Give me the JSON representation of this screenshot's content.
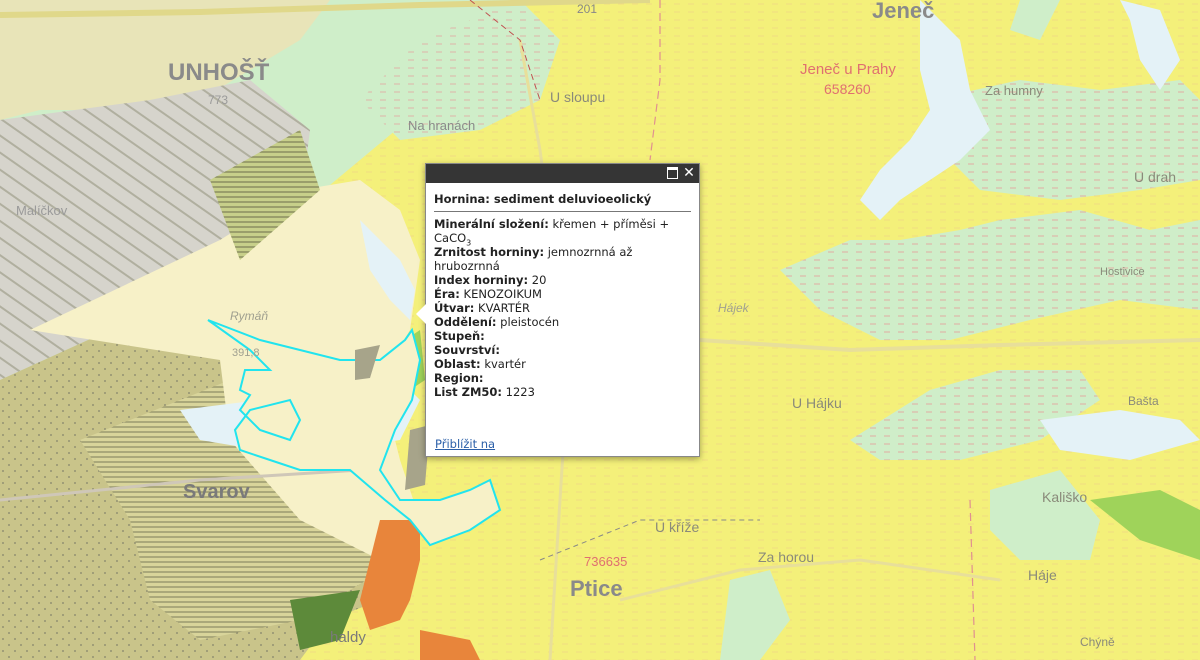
{
  "map_labels": {
    "unhost": "UNHOŠŤ",
    "jenec": "Jeneč",
    "jenec_u_prahy": "Jeneč u Prahy",
    "jenec_code": "658260",
    "road_201": "201",
    "u_sloupu": "U sloupu",
    "na_hranach": "Na hranách",
    "malicky": "Malíčkov",
    "rymani": "Rymáň",
    "u_drah": "U drah",
    "hajek": "Hájek",
    "u_hajku": "U Hájku",
    "svarov": "Svarov",
    "ptice": "Ptice",
    "ptice_code": "736635",
    "u_krize": "U kříže",
    "za_horou": "Za horou",
    "za_humny": "Za humny",
    "hostivice": "Hostivice",
    "basta": "Bašta",
    "kalisko": "Kališko",
    "haje": "Háje",
    "chyne": "Chýně",
    "halda": "haldy",
    "unhost_code": "773",
    "elev": "391,8"
  },
  "colors": {
    "quaternary_yellow": "#f4f07a",
    "light_green": "#cfeec9",
    "cream": "#f7f1c8",
    "olive": "#c9c48a",
    "grey": "#d6d4cc",
    "water": "#e4f2f7",
    "highlight": "#21e4ee",
    "orange": "#e8853b",
    "green": "#9fd35a",
    "popup_bar": "#353535"
  },
  "popup": {
    "title": "Hornina: sediment deluvioeolický",
    "rows": [
      {
        "label": "Minerální složení:",
        "value": "křemen + příměsi + CaCO3"
      },
      {
        "label": "Zrnitost horniny:",
        "value": "jemnozrnná až hrubozrnná"
      },
      {
        "label": "Index horniny:",
        "value": "20"
      },
      {
        "label": "Éra:",
        "value": "KENOZOIKUM"
      },
      {
        "label": "Útvar:",
        "value": "KVARTÉR"
      },
      {
        "label": "Oddělení:",
        "value": "pleistocén"
      },
      {
        "label": "Stupeň:",
        "value": ""
      },
      {
        "label": "Souvrství:",
        "value": ""
      },
      {
        "label": "Oblast:",
        "value": "kvartér"
      },
      {
        "label": "Region:",
        "value": ""
      },
      {
        "label": "List ZM50:",
        "value": "1223"
      }
    ],
    "mineral_value_main": "křemen + příměsi +",
    "mineral_value_formula": "CaCO",
    "mineral_value_sub": "3",
    "zoom_link": "Přiblížit na",
    "maximize_icon": "maximize-icon",
    "close_icon": "close-icon",
    "close_glyph": "✕"
  }
}
